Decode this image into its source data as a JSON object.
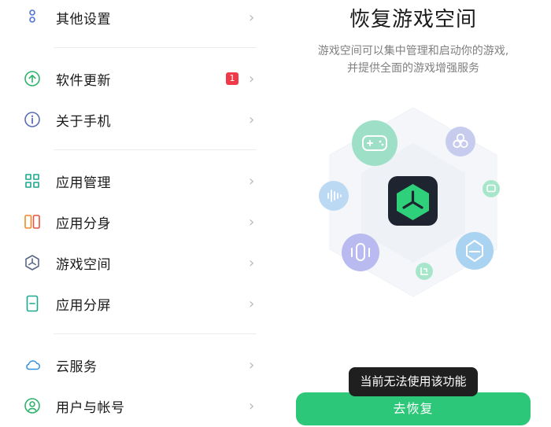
{
  "settings": {
    "items": [
      {
        "label": "其他设置",
        "icon": "more-settings-icon"
      },
      {
        "label": "软件更新",
        "icon": "software-update-icon",
        "badge": "1"
      },
      {
        "label": "关于手机",
        "icon": "about-phone-icon"
      },
      {
        "label": "应用管理",
        "icon": "app-management-icon"
      },
      {
        "label": "应用分身",
        "icon": "app-clone-icon"
      },
      {
        "label": "游戏空间",
        "icon": "game-space-icon"
      },
      {
        "label": "应用分屏",
        "icon": "split-screen-icon"
      },
      {
        "label": "云服务",
        "icon": "cloud-service-icon"
      },
      {
        "label": "用户与帐号",
        "icon": "user-account-icon"
      }
    ]
  },
  "game_space": {
    "title": "恢复游戏空间",
    "description_line1": "游戏空间可以集中管理和启动你的游戏,",
    "description_line2": "并提供全面的游戏增强服务",
    "restore_button": "去恢复"
  },
  "toast": {
    "message": "当前无法使用该功能"
  },
  "colors": {
    "accent_green": "#2dc77a",
    "badge_red": "#f03a4a",
    "toast_bg": "#1f1f1f"
  }
}
